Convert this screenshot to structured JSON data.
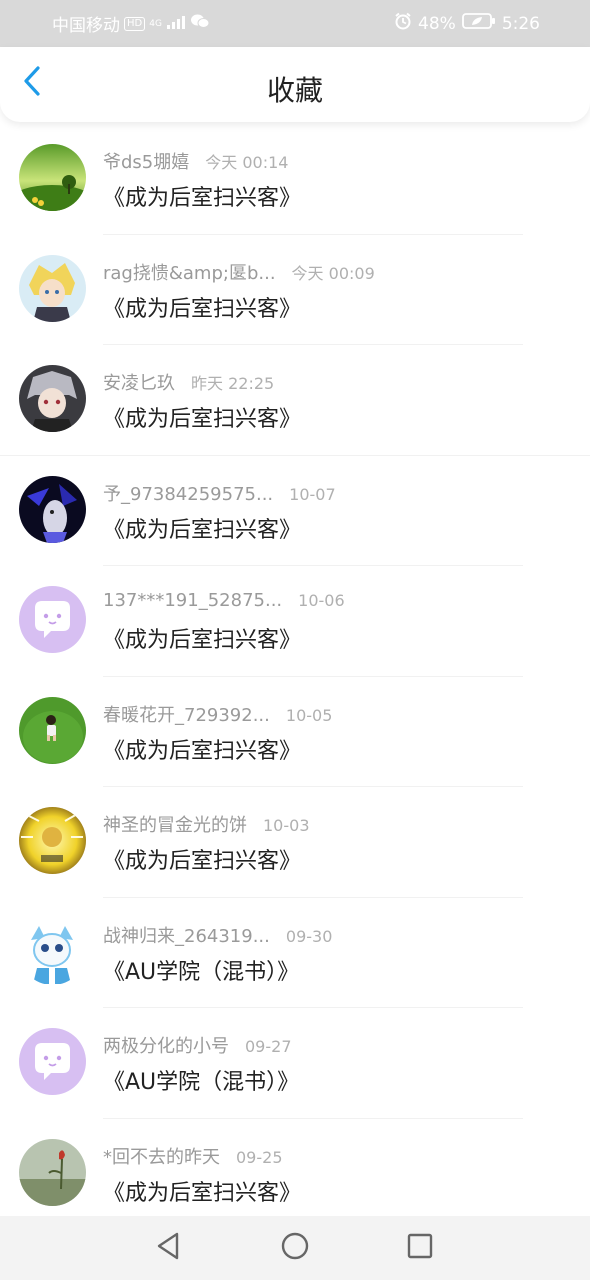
{
  "status_bar": {
    "carrier": "中国移动",
    "network_badge": "HD",
    "network_type": "4G",
    "battery_percent": "48%",
    "time": "5:26",
    "icons": [
      "signal-icon",
      "wechat-icon",
      "alarm-icon",
      "battery-icon"
    ]
  },
  "header": {
    "title": "收藏",
    "back_icon": "chevron-left-icon",
    "accent_color": "#1e9be8"
  },
  "favorites": [
    {
      "user": "爷ds5堋嬉",
      "time": "今天 00:14",
      "book": "《成为后室扫兴客》",
      "avatar": "landscape"
    },
    {
      "user": "rag挠愦&amp;匽b...",
      "time": "今天 00:09",
      "book": "《成为后室扫兴客》",
      "avatar": "anime-blond"
    },
    {
      "user": "安凌匕玖",
      "time": "昨天 22:25",
      "book": "《成为后室扫兴客》",
      "avatar": "anime-gray"
    },
    {
      "user": "予_97384259575...",
      "time": "10-07",
      "book": "《成为后室扫兴客》",
      "avatar": "dark-wolf"
    },
    {
      "user": "137***191_52875...",
      "time": "10-06",
      "book": "《成为后室扫兴客》",
      "avatar": "default-chat"
    },
    {
      "user": "春暖花开_729392...",
      "time": "10-05",
      "book": "《成为后室扫兴客》",
      "avatar": "grass-child"
    },
    {
      "user": "神圣的冒金光的饼",
      "time": "10-03",
      "book": "《成为后室扫兴客》",
      "avatar": "golden-cake"
    },
    {
      "user": "战神归来_264319...",
      "time": "09-30",
      "book": "《AU学院（混书）》",
      "avatar": "blue-sans"
    },
    {
      "user": "两极分化的小号",
      "time": "09-27",
      "book": "《AU学院（混书）》",
      "avatar": "default-chat"
    },
    {
      "user": "*回不去的昨天",
      "time": "09-25",
      "book": "《成为后室扫兴客》",
      "avatar": "flower"
    }
  ],
  "nav_bar": {
    "buttons": [
      "back-triangle-icon",
      "home-circle-icon",
      "recents-square-icon"
    ]
  }
}
